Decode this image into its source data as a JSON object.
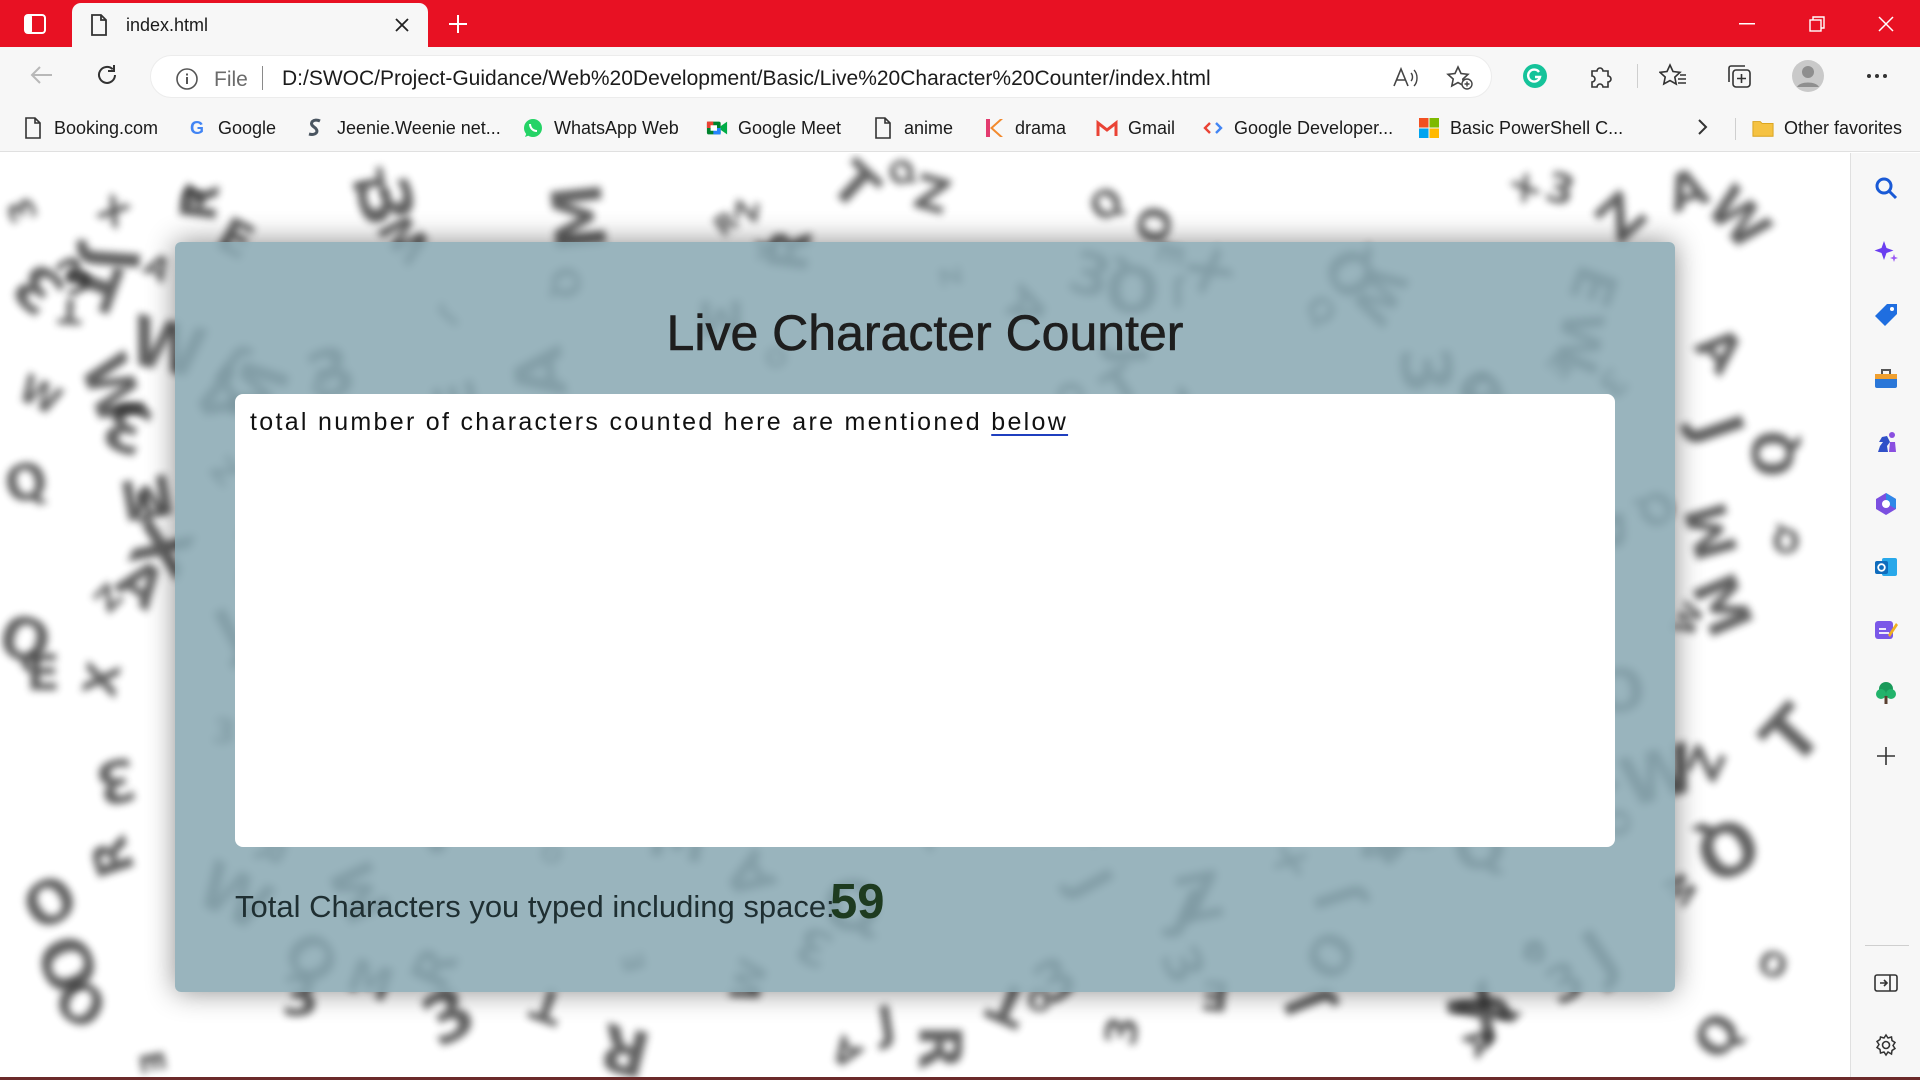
{
  "browser": {
    "tab": {
      "title": "index.html"
    },
    "address": {
      "scheme": "File",
      "url": "D:/SWOC/Project-Guidance/Web%20Development/Basic/Live%20Character%20Counter/index.html"
    },
    "favorites": [
      {
        "label": "Booking.com",
        "icon": "page-icon"
      },
      {
        "label": "Google",
        "icon": "google-icon"
      },
      {
        "label": "Jeenie.Weenie net...",
        "icon": "jeenie-icon"
      },
      {
        "label": "WhatsApp Web",
        "icon": "whatsapp-icon"
      },
      {
        "label": "Google Meet",
        "icon": "meet-icon"
      },
      {
        "label": "anime",
        "icon": "page-icon"
      },
      {
        "label": "drama",
        "icon": "kdrama-icon"
      },
      {
        "label": "Gmail",
        "icon": "gmail-icon"
      },
      {
        "label": "Google Developer...",
        "icon": "developers-icon"
      },
      {
        "label": "Basic PowerShell C...",
        "icon": "microsoft-icon"
      }
    ],
    "other_favorites": "Other favorites",
    "colors": {
      "titlebar": "#e81123",
      "toolbar": "#f7f7f7"
    }
  },
  "app": {
    "title": "Live Character Counter",
    "text_before": "total number of characters counted here are mentioned ",
    "text_underlined": "below",
    "count_label": "Total Characters you typed including space:",
    "count_value": "59",
    "card_color": "#88a8b2"
  }
}
